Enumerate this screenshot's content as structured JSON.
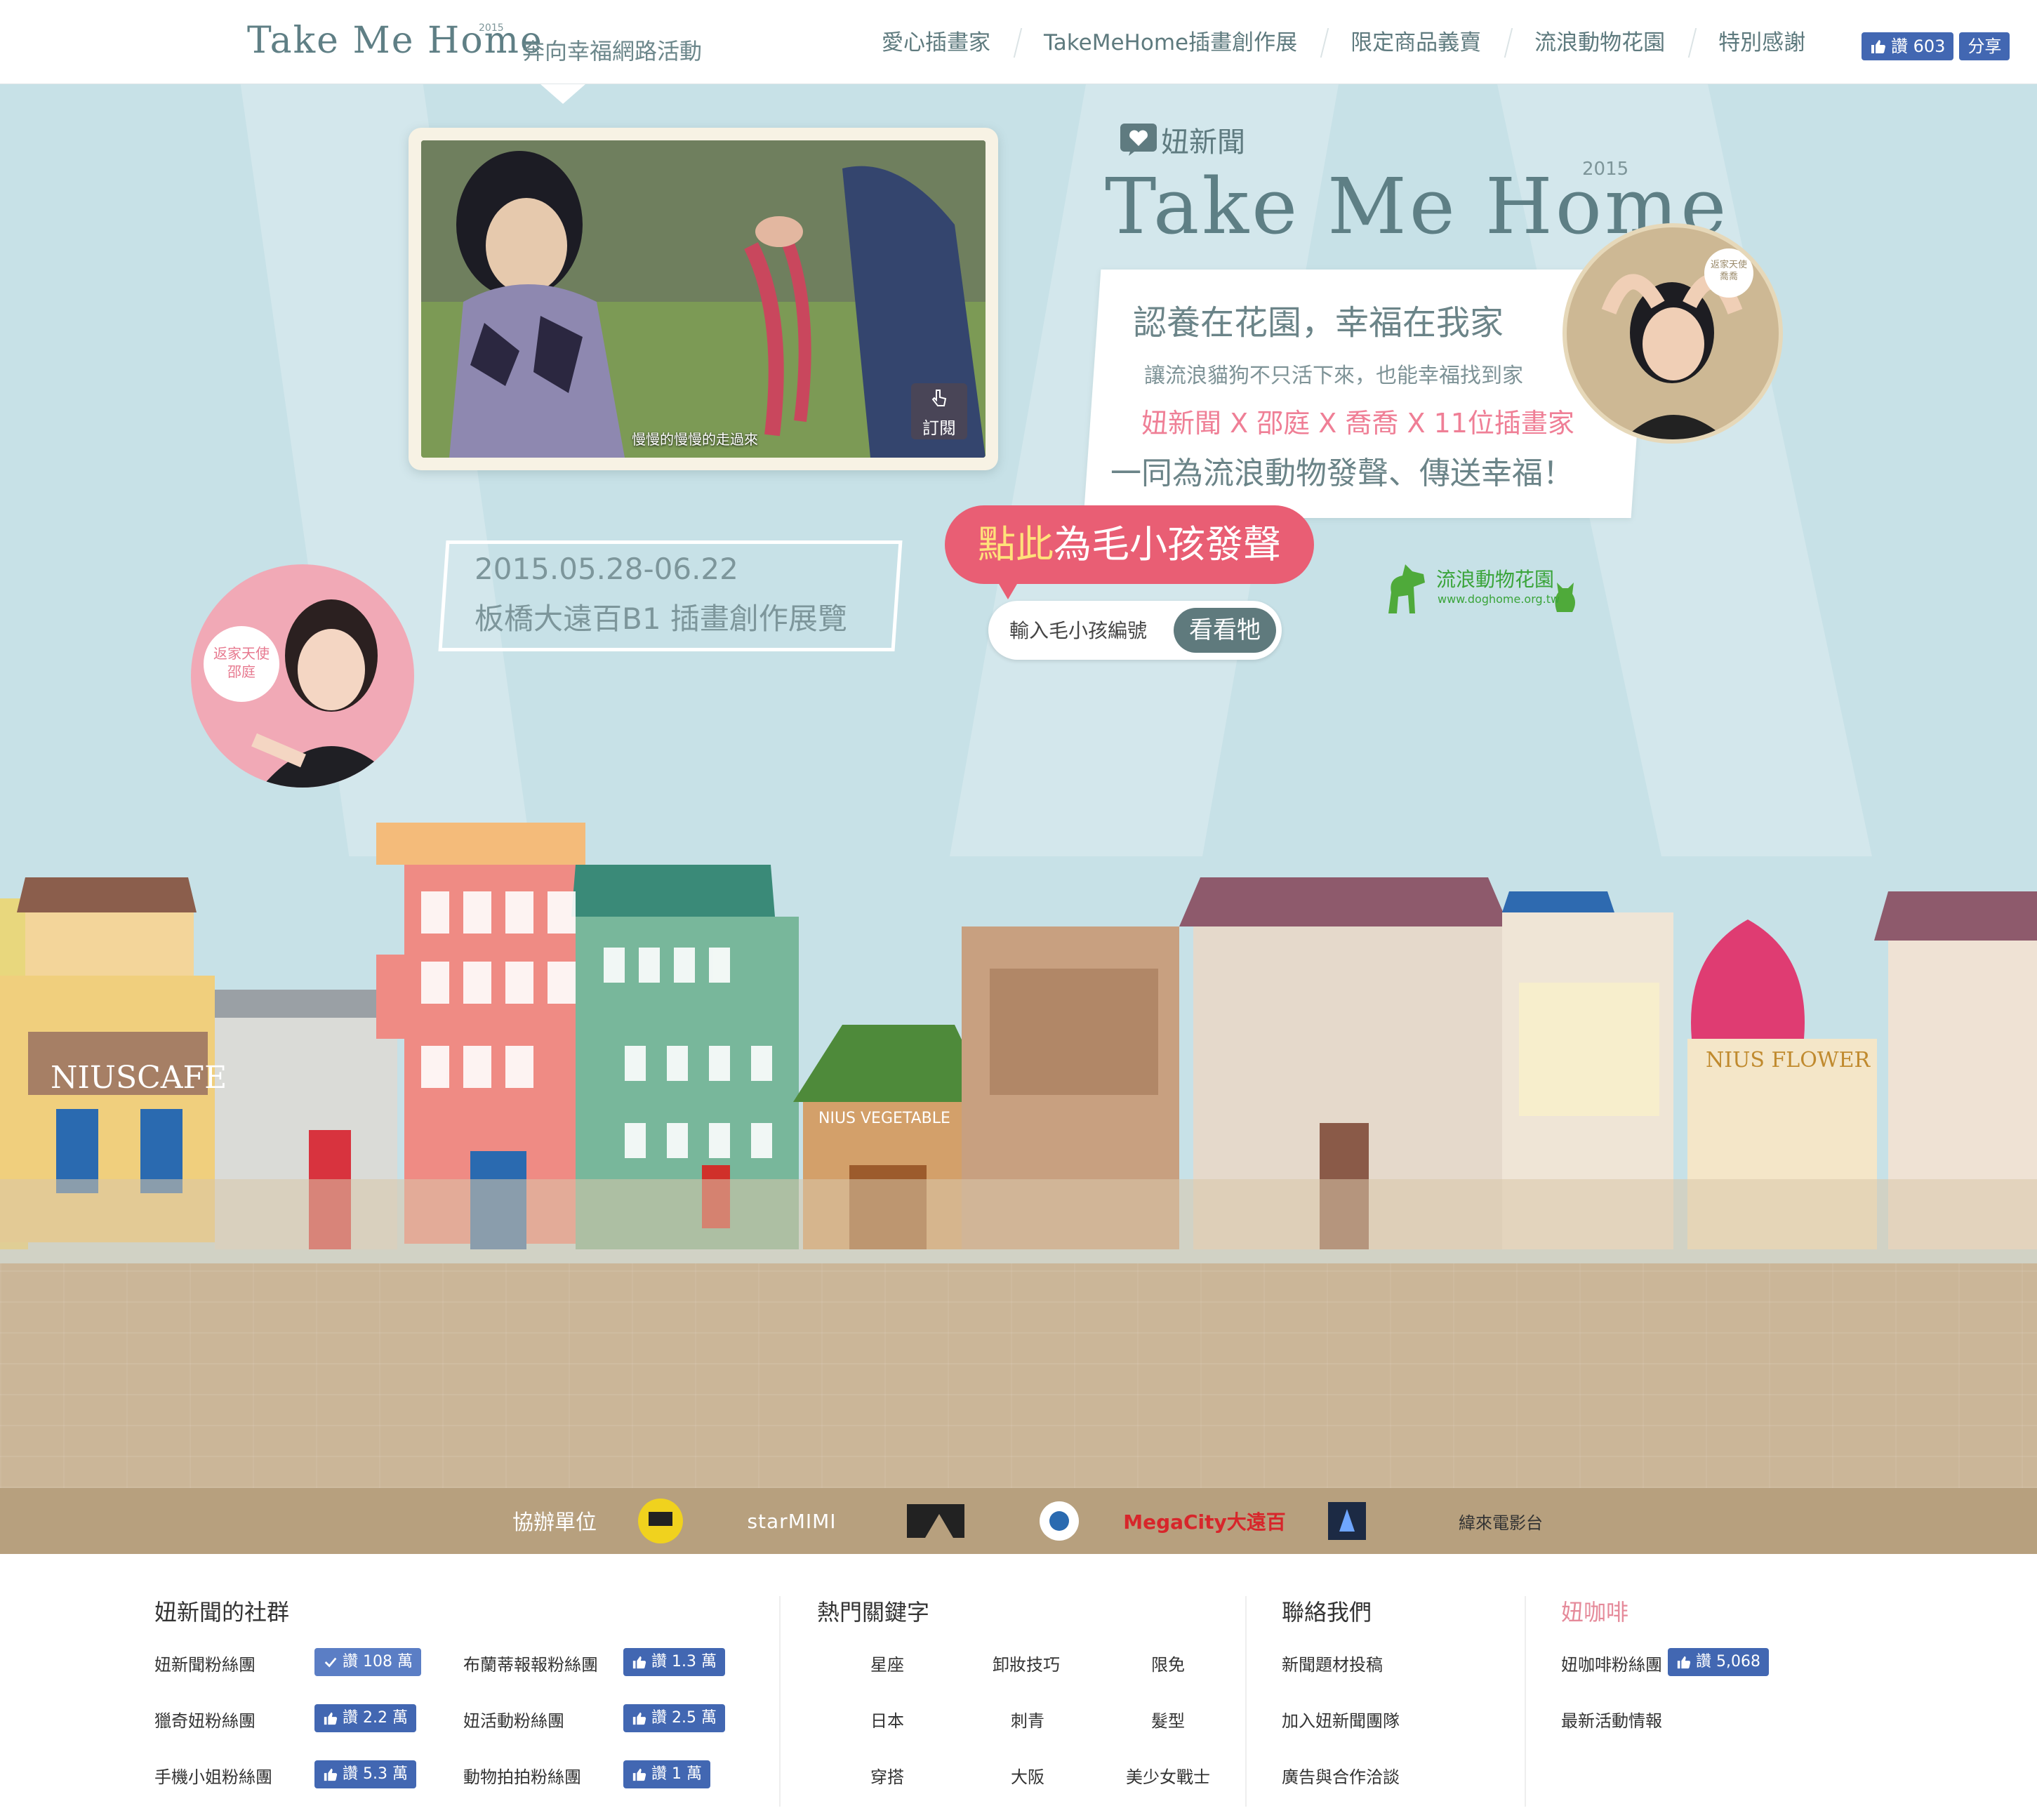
{
  "header": {
    "logo": "Take Me Home",
    "logo_year": "2015",
    "logo_sub": "奔向幸福網路活動",
    "nav": [
      "愛心插畫家",
      "TakeMeHome插畫創作展",
      "限定商品義賣",
      "流浪動物花園",
      "特別感謝"
    ],
    "fb_like": "讚 603",
    "fb_share": "分享"
  },
  "hero": {
    "video_caption": "慢慢的慢慢的走過來",
    "subscribe": "訂閱",
    "nius_brand": "妞新聞",
    "big_logo": "Take Me Home",
    "big_year": "2015",
    "slogan_1": "認養在花園，幸福在我家",
    "slogan_2": "讓流浪貓狗不只活下來，也能幸福找到家",
    "slogan_3": "妞新聞 X 邵庭 X 喬喬 X 11位插畫家",
    "slogan_4": "一同為流浪動物發聲、傳送幸福！",
    "angel_qiao_title": "返家天使",
    "angel_qiao_name": "喬喬",
    "angel_shao_title": "返家天使",
    "angel_shao_name": "邵庭",
    "expo_date": "2015.05.28-06.22",
    "expo_place": "板橋大遠百B1 插畫創作展覽",
    "voice_hl": "點此",
    "voice_rest": "為毛小孩發聲",
    "search_placeholder": "輸入毛小孩編號",
    "search_button": "看看牠",
    "doghome_name": "流浪動物花園",
    "doghome_url": "www.doghome.org.tw",
    "shop_cafe": "NIUSCAFE",
    "shop_vegetable": "NIUS VEGETABLE",
    "shop_flower": "NIUS FLOWER",
    "sponsor_label": "協辦單位",
    "sponsors": [
      "starMIMI",
      "MegaCity大遠百",
      "緯來電影台"
    ]
  },
  "footer": {
    "community": {
      "title": "妞新聞的社群",
      "items": [
        {
          "name": "妞新聞粉絲團",
          "like": "讚 108 萬"
        },
        {
          "name": "布蘭蒂報報粉絲團",
          "like": "讚 1.3 萬"
        },
        {
          "name": "獵奇妞粉絲團",
          "like": "讚 2.2 萬"
        },
        {
          "name": "妞活動粉絲團",
          "like": "讚 2.5 萬"
        },
        {
          "name": "手機小姐粉絲團",
          "like": "讚 5.3 萬"
        },
        {
          "name": "動物拍拍粉絲團",
          "like": "讚 1 萬"
        }
      ]
    },
    "keywords": {
      "title": "熱門關鍵字",
      "items": [
        "星座",
        "卸妝技巧",
        "限免",
        "日本",
        "刺青",
        "髮型",
        "穿搭",
        "大阪",
        "美少女戰士"
      ]
    },
    "contact": {
      "title": "聯絡我們",
      "items": [
        "新聞題材投稿",
        "加入妞新聞團隊",
        "廣告與合作洽談"
      ]
    },
    "cafe": {
      "title": "妞咖啡",
      "fan_page": "妞咖啡粉絲團",
      "like": "讚 5,068",
      "news": "最新活動情報"
    }
  },
  "colors": {
    "sky": "#c7e1e7",
    "accent_pink": "#e95e74",
    "text_teal": "#5e7a7e",
    "fb_blue": "#4267b2",
    "ground": "#cbb698",
    "sponsor_bar": "#b7a07e"
  }
}
